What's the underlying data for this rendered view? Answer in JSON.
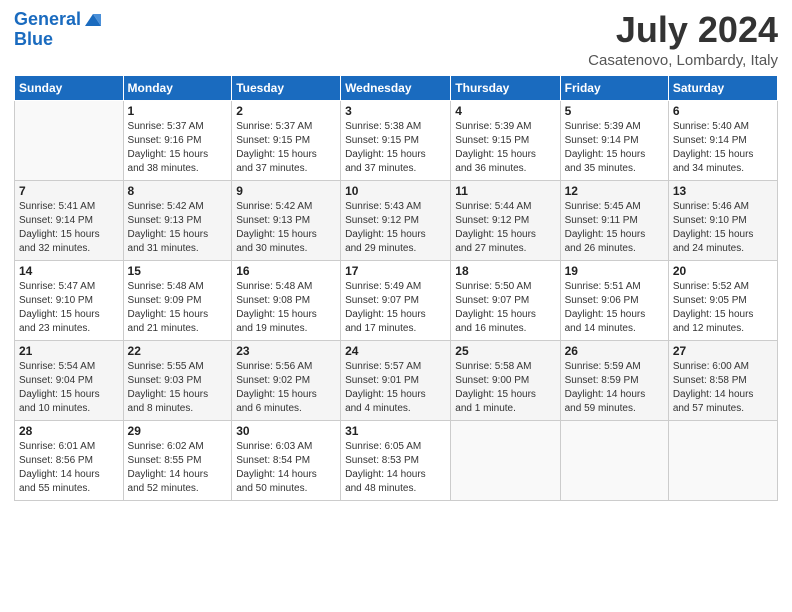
{
  "header": {
    "logo_line1": "General",
    "logo_line2": "Blue",
    "month_title": "July 2024",
    "location": "Casatenovo, Lombardy, Italy"
  },
  "days_of_week": [
    "Sunday",
    "Monday",
    "Tuesday",
    "Wednesday",
    "Thursday",
    "Friday",
    "Saturday"
  ],
  "weeks": [
    [
      {
        "day": "",
        "info": ""
      },
      {
        "day": "1",
        "info": "Sunrise: 5:37 AM\nSunset: 9:16 PM\nDaylight: 15 hours\nand 38 minutes."
      },
      {
        "day": "2",
        "info": "Sunrise: 5:37 AM\nSunset: 9:15 PM\nDaylight: 15 hours\nand 37 minutes."
      },
      {
        "day": "3",
        "info": "Sunrise: 5:38 AM\nSunset: 9:15 PM\nDaylight: 15 hours\nand 37 minutes."
      },
      {
        "day": "4",
        "info": "Sunrise: 5:39 AM\nSunset: 9:15 PM\nDaylight: 15 hours\nand 36 minutes."
      },
      {
        "day": "5",
        "info": "Sunrise: 5:39 AM\nSunset: 9:14 PM\nDaylight: 15 hours\nand 35 minutes."
      },
      {
        "day": "6",
        "info": "Sunrise: 5:40 AM\nSunset: 9:14 PM\nDaylight: 15 hours\nand 34 minutes."
      }
    ],
    [
      {
        "day": "7",
        "info": "Sunrise: 5:41 AM\nSunset: 9:14 PM\nDaylight: 15 hours\nand 32 minutes."
      },
      {
        "day": "8",
        "info": "Sunrise: 5:42 AM\nSunset: 9:13 PM\nDaylight: 15 hours\nand 31 minutes."
      },
      {
        "day": "9",
        "info": "Sunrise: 5:42 AM\nSunset: 9:13 PM\nDaylight: 15 hours\nand 30 minutes."
      },
      {
        "day": "10",
        "info": "Sunrise: 5:43 AM\nSunset: 9:12 PM\nDaylight: 15 hours\nand 29 minutes."
      },
      {
        "day": "11",
        "info": "Sunrise: 5:44 AM\nSunset: 9:12 PM\nDaylight: 15 hours\nand 27 minutes."
      },
      {
        "day": "12",
        "info": "Sunrise: 5:45 AM\nSunset: 9:11 PM\nDaylight: 15 hours\nand 26 minutes."
      },
      {
        "day": "13",
        "info": "Sunrise: 5:46 AM\nSunset: 9:10 PM\nDaylight: 15 hours\nand 24 minutes."
      }
    ],
    [
      {
        "day": "14",
        "info": "Sunrise: 5:47 AM\nSunset: 9:10 PM\nDaylight: 15 hours\nand 23 minutes."
      },
      {
        "day": "15",
        "info": "Sunrise: 5:48 AM\nSunset: 9:09 PM\nDaylight: 15 hours\nand 21 minutes."
      },
      {
        "day": "16",
        "info": "Sunrise: 5:48 AM\nSunset: 9:08 PM\nDaylight: 15 hours\nand 19 minutes."
      },
      {
        "day": "17",
        "info": "Sunrise: 5:49 AM\nSunset: 9:07 PM\nDaylight: 15 hours\nand 17 minutes."
      },
      {
        "day": "18",
        "info": "Sunrise: 5:50 AM\nSunset: 9:07 PM\nDaylight: 15 hours\nand 16 minutes."
      },
      {
        "day": "19",
        "info": "Sunrise: 5:51 AM\nSunset: 9:06 PM\nDaylight: 15 hours\nand 14 minutes."
      },
      {
        "day": "20",
        "info": "Sunrise: 5:52 AM\nSunset: 9:05 PM\nDaylight: 15 hours\nand 12 minutes."
      }
    ],
    [
      {
        "day": "21",
        "info": "Sunrise: 5:54 AM\nSunset: 9:04 PM\nDaylight: 15 hours\nand 10 minutes."
      },
      {
        "day": "22",
        "info": "Sunrise: 5:55 AM\nSunset: 9:03 PM\nDaylight: 15 hours\nand 8 minutes."
      },
      {
        "day": "23",
        "info": "Sunrise: 5:56 AM\nSunset: 9:02 PM\nDaylight: 15 hours\nand 6 minutes."
      },
      {
        "day": "24",
        "info": "Sunrise: 5:57 AM\nSunset: 9:01 PM\nDaylight: 15 hours\nand 4 minutes."
      },
      {
        "day": "25",
        "info": "Sunrise: 5:58 AM\nSunset: 9:00 PM\nDaylight: 15 hours\nand 1 minute."
      },
      {
        "day": "26",
        "info": "Sunrise: 5:59 AM\nSunset: 8:59 PM\nDaylight: 14 hours\nand 59 minutes."
      },
      {
        "day": "27",
        "info": "Sunrise: 6:00 AM\nSunset: 8:58 PM\nDaylight: 14 hours\nand 57 minutes."
      }
    ],
    [
      {
        "day": "28",
        "info": "Sunrise: 6:01 AM\nSunset: 8:56 PM\nDaylight: 14 hours\nand 55 minutes."
      },
      {
        "day": "29",
        "info": "Sunrise: 6:02 AM\nSunset: 8:55 PM\nDaylight: 14 hours\nand 52 minutes."
      },
      {
        "day": "30",
        "info": "Sunrise: 6:03 AM\nSunset: 8:54 PM\nDaylight: 14 hours\nand 50 minutes."
      },
      {
        "day": "31",
        "info": "Sunrise: 6:05 AM\nSunset: 8:53 PM\nDaylight: 14 hours\nand 48 minutes."
      },
      {
        "day": "",
        "info": ""
      },
      {
        "day": "",
        "info": ""
      },
      {
        "day": "",
        "info": ""
      }
    ]
  ]
}
